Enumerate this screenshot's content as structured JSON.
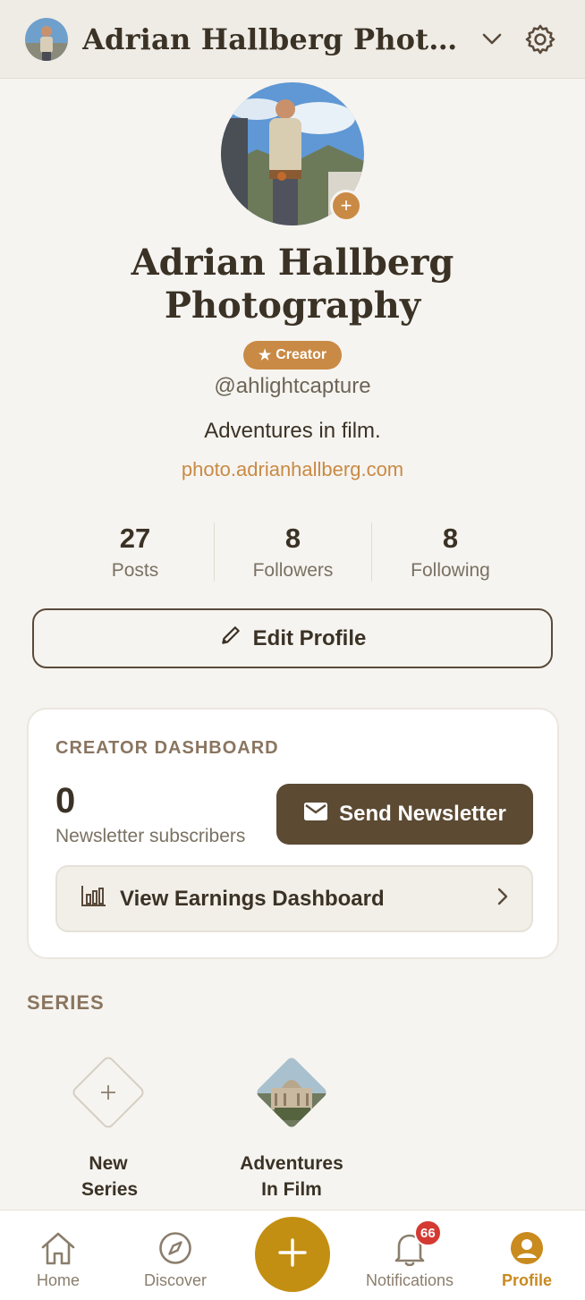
{
  "header": {
    "title": "Adrian Hallberg Photography",
    "avatar_icon": "user-avatar-photo",
    "dropdown_icon": "chevron-down-icon",
    "settings_icon": "gear-icon"
  },
  "profile": {
    "name": "Adrian Hallberg Photography",
    "badge": "Creator",
    "handle": "@ahlightcapture",
    "bio": "Adventures in film.",
    "website": "photo.adrianhallberg.com",
    "add_photo_icon": "plus-icon"
  },
  "stats": [
    {
      "value": "27",
      "label": "Posts"
    },
    {
      "value": "8",
      "label": "Followers"
    },
    {
      "value": "8",
      "label": "Following"
    }
  ],
  "edit_profile": {
    "label": "Edit Profile",
    "icon": "pencil-icon"
  },
  "dashboard": {
    "title": "CREATOR DASHBOARD",
    "subscriber_count": "0",
    "subscriber_label": "Newsletter subscribers",
    "send_newsletter": "Send Newsletter",
    "earnings": "View Earnings Dashboard"
  },
  "series": {
    "heading": "SERIES",
    "items": [
      {
        "label": "New Series",
        "icon": "plus-icon"
      },
      {
        "label": "Adventures In Film",
        "icon": "series-thumbnail"
      }
    ]
  },
  "nav": {
    "items": [
      {
        "label": "Home",
        "icon": "home-icon"
      },
      {
        "label": "Discover",
        "icon": "compass-icon"
      },
      {
        "label": "Notifications",
        "icon": "bell-icon",
        "badge": "66"
      },
      {
        "label": "Profile",
        "icon": "user-circle-icon"
      }
    ],
    "create_icon": "plus-icon"
  },
  "colors": {
    "accent": "#c98a45",
    "brand_dark": "#5c4a33",
    "nav_active": "#c98a1e",
    "create_button": "#c38f12",
    "badge_red": "#d43a32"
  }
}
